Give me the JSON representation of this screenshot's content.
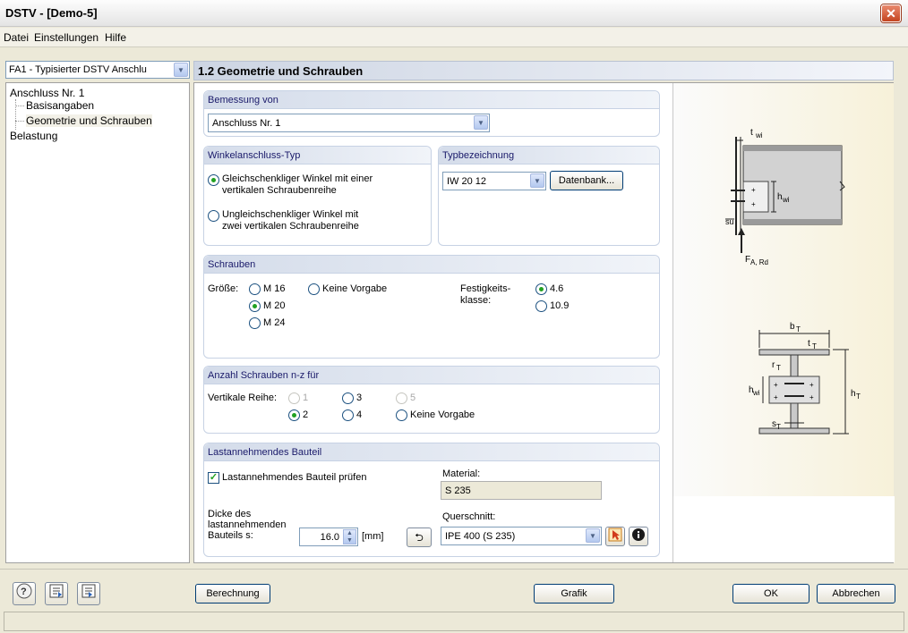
{
  "window": {
    "title": "DSTV - [Demo-5]",
    "close_icon": "close-icon"
  },
  "menu": [
    "Datei",
    "Einstellungen",
    "Hilfe"
  ],
  "nav": {
    "case_select": "FA1 - Typisierter DSTV Anschlu",
    "tree": {
      "root": "Anschluss Nr. 1",
      "child1": "Basisangaben",
      "child2": "Geometrie und Schrauben",
      "sibling": "Belastung"
    }
  },
  "panel_title": "1.2 Geometrie und Schrauben",
  "bemessung": {
    "title": "Bemessung von",
    "value": "Anschluss Nr. 1"
  },
  "winkel": {
    "title": "Winkelanschluss-Typ",
    "opt1_line1": "Gleichschenkliger Winkel mit einer",
    "opt1_line2": "vertikalen Schraubenreihe",
    "opt2_line1": "Ungleichschenkliger Winkel mit",
    "opt2_line2": "zwei vertikalen Schraubenreihe"
  },
  "typ": {
    "title": "Typbezeichnung",
    "value": "IW 20 12",
    "db_button": "Datenbank..."
  },
  "schrauben": {
    "title": "Schrauben",
    "size_label": "Größe:",
    "m16": "M 16",
    "m20": "M 20",
    "m24": "M 24",
    "none": "Keine Vorgabe",
    "class_line1": "Festigkeits-",
    "class_line2": "klasse:",
    "c46": "4.6",
    "c109": "10.9"
  },
  "anzahl": {
    "title": "Anzahl Schrauben n-z für",
    "row_label": "Vertikale Reihe:",
    "n1": "1",
    "n2": "2",
    "n3": "3",
    "n4": "4",
    "n5": "5",
    "none": "Keine Vorgabe"
  },
  "bauteil": {
    "title": "Lastannehmendes Bauteil",
    "check": "Lastannehmendes Bauteil prüfen",
    "material_label": "Material:",
    "material": "S 235",
    "dicke_line1": "Dicke des",
    "dicke_line2": "lastannehmenden",
    "dicke_line3": "Bauteils s:",
    "dicke_value": "16.0",
    "dicke_unit": "[mm]",
    "qs_label": "Querschnitt:",
    "qs_value": "IPE 400 (S 235)"
  },
  "graphic": {
    "top": {
      "twi": "t",
      "twi_sub": "wi",
      "hwi": "h",
      "hwi_sub": "wi",
      "su": "su",
      "fa": "F",
      "fa_sub": "A, Rd"
    },
    "bottom": {
      "bt": "b",
      "bt_sub": "T",
      "tt": "t",
      "tt_sub": "T",
      "rt": "r",
      "rt_sub": "T",
      "hwi": "h",
      "hwi_sub": "wi",
      "ht": "h",
      "ht_sub": "T",
      "st": "s",
      "st_sub": "T"
    }
  },
  "buttons": {
    "calc": "Berechnung",
    "graphic": "Grafik",
    "ok": "OK",
    "cancel": "Abbrechen"
  }
}
